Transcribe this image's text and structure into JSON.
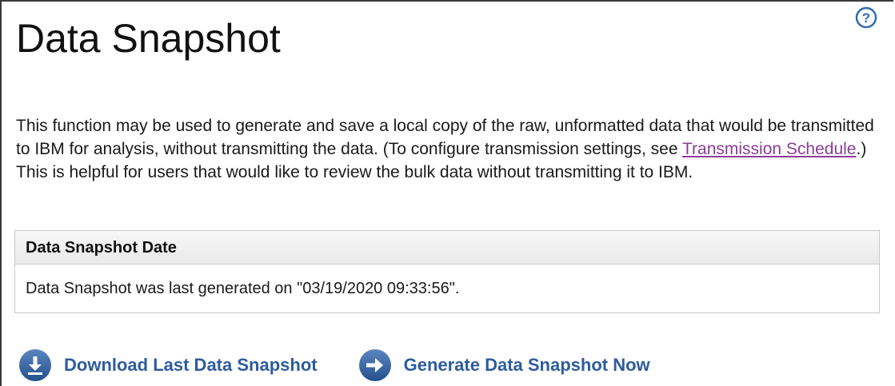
{
  "page": {
    "title": "Data Snapshot",
    "help_icon": "question-circle-icon"
  },
  "intro": {
    "text_before_link": "This function may be used to generate and save a local copy of the raw, unformatted data that would be transmitted to IBM for analysis, without transmitting the data. (To configure transmission settings, see ",
    "link_text": "Transmission Schedule",
    "text_after_link": ".) This is helpful for users that would like to review the bulk data without transmitting it to IBM."
  },
  "snapshot_panel": {
    "header": "Data Snapshot Date",
    "message": "Data Snapshot was last generated on \"03/19/2020 09:33:56\"."
  },
  "actions": {
    "download": {
      "label": "Download Last Data Snapshot",
      "icon": "download-arrow-icon"
    },
    "generate": {
      "label": "Generate Data Snapshot Now",
      "icon": "right-arrow-icon"
    }
  },
  "colors": {
    "link": "#8b3d97",
    "action_text": "#2d5c9e",
    "action_icon": "#2f5f9c",
    "help_icon": "#2f6cb3"
  }
}
